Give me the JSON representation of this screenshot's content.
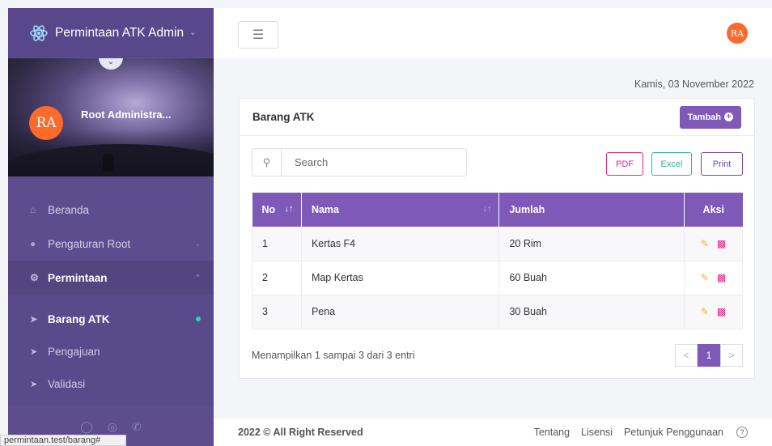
{
  "sidebar": {
    "brand": "Permintaan ATK Admin",
    "brand_caret": "⌄",
    "collapse_icon": "⌄",
    "profile": {
      "initials": "RA",
      "name": "Root Administra..."
    },
    "nav": [
      {
        "label": "Beranda",
        "icon": "home-icon"
      },
      {
        "label": "Pengaturan Root",
        "icon": "settings-icon"
      },
      {
        "label": "Permintaan",
        "icon": "gears-icon"
      }
    ],
    "submenu": [
      {
        "label": "Barang ATK",
        "active": true
      },
      {
        "label": "Pengajuan"
      },
      {
        "label": "Validasi"
      }
    ]
  },
  "status_url": "permintaan.test/barang#",
  "topbar": {
    "avatar_initials": "RA"
  },
  "date": "Kamis, 03 November 2022",
  "card": {
    "title": "Barang ATK",
    "add_label": "Tambah",
    "search_placeholder": "Search",
    "export": {
      "pdf": "PDF",
      "excel": "Excel",
      "print": "Print"
    },
    "columns": {
      "no": "No",
      "nama": "Nama",
      "jumlah": "Jumlah",
      "aksi": "Aksi"
    },
    "rows": [
      {
        "no": "1",
        "nama": "Kertas F4",
        "jumlah": "20 Rim"
      },
      {
        "no": "2",
        "nama": "Map Kertas",
        "jumlah": "60 Buah"
      },
      {
        "no": "3",
        "nama": "Pena",
        "jumlah": "30 Buah"
      }
    ],
    "info": "Menampilkan 1 sampai 3 dari 3 entri",
    "pagination": {
      "prev": "<",
      "current": "1",
      "next": ">"
    }
  },
  "footer": {
    "copyright": "2022 © All Right Reserved",
    "links": [
      "Tentang",
      "Lisensi",
      "Petunjuk Penggunaan"
    ],
    "help": "?"
  },
  "colors": {
    "primary": "#7e59b8",
    "sidebar": "#5d4d8f",
    "avatar": "#fd6a2c",
    "pdf": "#e0278f",
    "excel": "#2bb89d"
  }
}
